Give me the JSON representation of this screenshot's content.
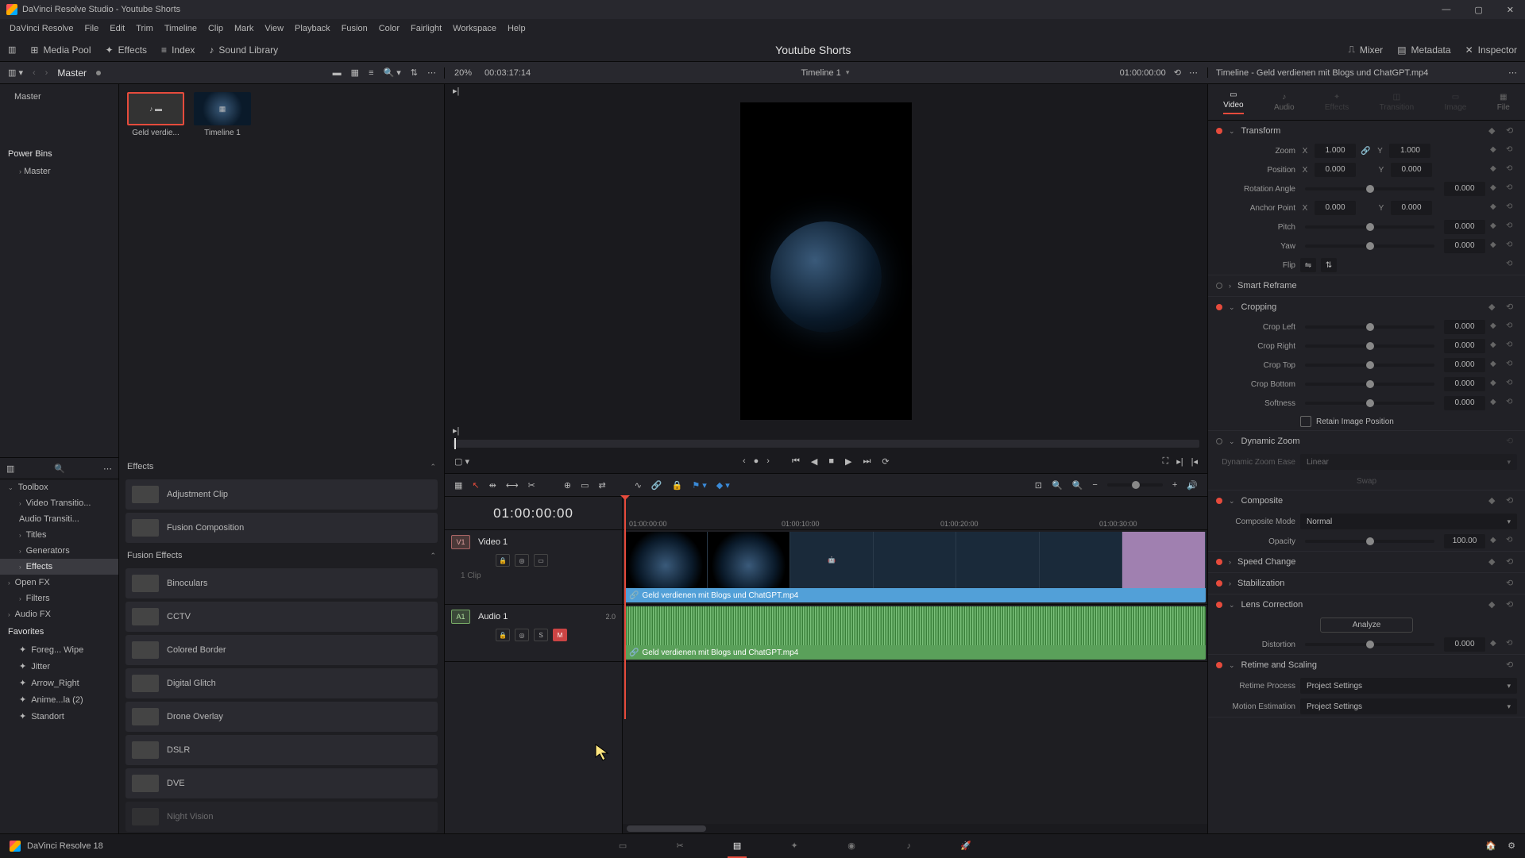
{
  "app": {
    "title": "DaVinci Resolve Studio - Youtube Shorts",
    "version": "DaVinci Resolve 18"
  },
  "menubar": [
    "DaVinci Resolve",
    "File",
    "Edit",
    "Trim",
    "Timeline",
    "Clip",
    "Mark",
    "View",
    "Playback",
    "Fusion",
    "Color",
    "Fairlight",
    "Workspace",
    "Help"
  ],
  "topbar": {
    "media_pool": "Media Pool",
    "effects": "Effects",
    "index": "Index",
    "sound": "Sound Library",
    "title": "Youtube Shorts",
    "mixer": "Mixer",
    "metadata": "Metadata",
    "inspector": "Inspector"
  },
  "subbar": {
    "master": "Master",
    "zoom_pct": "20%",
    "source_tc": "00:03:17:14",
    "timeline_name": "Timeline 1",
    "timeline_tc": "01:00:00:00",
    "insp_title": "Timeline - Geld verdienen mit Blogs und ChatGPT.mp4"
  },
  "left_tree": {
    "master": "Master",
    "power_bins": "Power Bins",
    "power_master": "Master"
  },
  "media": [
    {
      "name": "Geld verdie..."
    },
    {
      "name": "Timeline 1"
    }
  ],
  "toolbox": {
    "header": "Toolbox",
    "items": [
      "Video Transitio...",
      "Audio Transiti...",
      "Titles",
      "Generators",
      "Effects"
    ],
    "open_fx": "Open FX",
    "filters": "Filters",
    "audio_fx": "Audio FX"
  },
  "favorites": {
    "header": "Favorites",
    "items": [
      "Foreg... Wipe",
      "Jitter",
      "Arrow_Right",
      "Anime...la (2)",
      "Standort"
    ]
  },
  "fx_panel": {
    "header": "Effects",
    "basic": [
      "Adjustment Clip",
      "Fusion Composition"
    ],
    "fusion_header": "Fusion Effects",
    "fusion": [
      "Binoculars",
      "CCTV",
      "Colored Border",
      "Digital Glitch",
      "Drone Overlay",
      "DSLR",
      "DVE",
      "Night Vision"
    ]
  },
  "timeline": {
    "big_tc": "01:00:00:00",
    "ticks": [
      "01:00:00:00",
      "01:00:10:00",
      "01:00:20:00",
      "01:00:30:00"
    ],
    "v1": "Video 1",
    "v1_tag": "V1",
    "a1": "Audio 1",
    "a1_tag": "A1",
    "a1_ch": "2.0",
    "clip_count": "1 Clip",
    "clip_name": "Geld verdienen mit Blogs und ChatGPT.mp4",
    "s": "S",
    "m": "M"
  },
  "inspector": {
    "tabs": [
      "Video",
      "Audio",
      "Effects",
      "Transition",
      "Image",
      "File"
    ],
    "transform": {
      "hdr": "Transform",
      "zoom": "Zoom",
      "x": "X",
      "y": "Y",
      "zoom_x": "1.000",
      "zoom_y": "1.000",
      "position": "Position",
      "pos_x": "0.000",
      "pos_y": "0.000",
      "rotation": "Rotation Angle",
      "rot_v": "0.000",
      "anchor": "Anchor Point",
      "anc_x": "0.000",
      "anc_y": "0.000",
      "pitch": "Pitch",
      "pitch_v": "0.000",
      "yaw": "Yaw",
      "yaw_v": "0.000",
      "flip": "Flip"
    },
    "smart_reframe": "Smart Reframe",
    "crop": {
      "hdr": "Cropping",
      "left": "Crop Left",
      "right": "Crop Right",
      "top": "Crop Top",
      "bottom": "Crop Bottom",
      "soft": "Softness",
      "v": "0.000",
      "retain": "Retain Image Position"
    },
    "dynamic_zoom": {
      "hdr": "Dynamic Zoom",
      "ease": "Dynamic Zoom Ease",
      "ease_v": "Linear",
      "swap": "Swap"
    },
    "composite": {
      "hdr": "Composite",
      "mode": "Composite Mode",
      "mode_v": "Normal",
      "opacity": "Opacity",
      "opacity_v": "100.00"
    },
    "speed": "Speed Change",
    "stab": "Stabilization",
    "lens": {
      "hdr": "Lens Correction",
      "analyze": "Analyze",
      "distortion": "Distortion",
      "v": "0.000"
    },
    "retime": {
      "hdr": "Retime and Scaling",
      "process": "Retime Process",
      "process_v": "Project Settings",
      "motion": "Motion Estimation",
      "motion_v": "Project Settings"
    }
  }
}
